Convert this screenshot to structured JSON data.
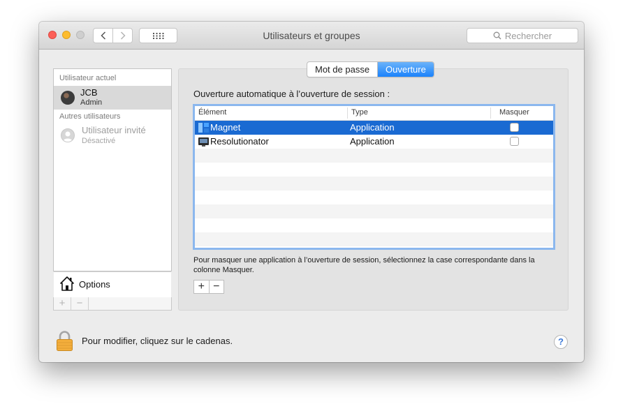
{
  "window": {
    "title": "Utilisateurs et groupes",
    "search_placeholder": "Rechercher"
  },
  "sidebar": {
    "current_heading": "Utilisateur actuel",
    "current_user": {
      "name": "JCB",
      "role": "Admin"
    },
    "others_heading": "Autres utilisateurs",
    "guest_user": {
      "name": "Utilisateur invité",
      "status": "Désactivé"
    },
    "options_label": "Options",
    "add_symbol": "+",
    "remove_symbol": "−"
  },
  "tabs": [
    {
      "label": "Mot de passe",
      "active": false
    },
    {
      "label": "Ouverture",
      "active": true
    }
  ],
  "login_items": {
    "heading": "Ouverture automatique à l’ouverture de session :",
    "columns": {
      "item": "Élément",
      "type": "Type",
      "hide": "Masquer"
    },
    "rows": [
      {
        "name": "Magnet",
        "type": "Application",
        "hidden": false,
        "selected": true,
        "icon": "magnet-icon"
      },
      {
        "name": "Resolutionator",
        "type": "Application",
        "hidden": false,
        "selected": false,
        "icon": "resolutionator-icon"
      }
    ],
    "hint": "Pour masquer une application à l’ouverture de session, sélectionnez la case correspondante dans la colonne Masquer.",
    "add_symbol": "+",
    "remove_symbol": "−"
  },
  "footer": {
    "lock_label": "Pour modifier, cliquez sur le cadenas.",
    "help_symbol": "?"
  },
  "colors": {
    "selection": "#1a6ad2",
    "tab_active": "#1a82fb",
    "focus_ring": "#8bb7ee"
  }
}
